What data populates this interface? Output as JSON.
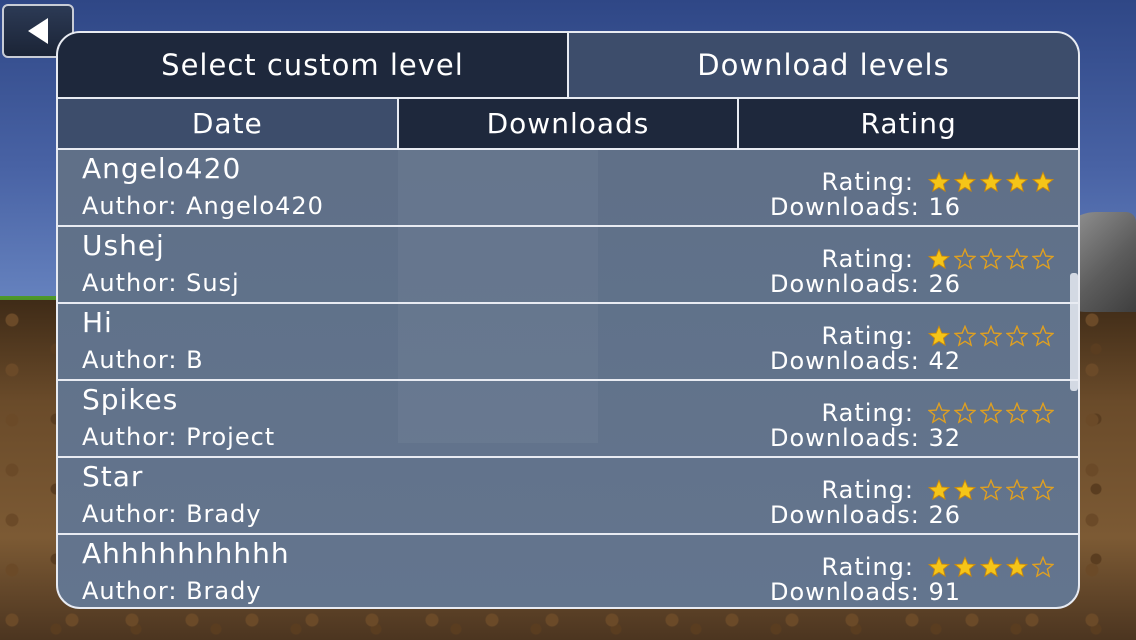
{
  "tabs": {
    "select_custom": "Select custom level",
    "download_levels": "Download levels"
  },
  "sort": {
    "date": "Date",
    "downloads": "Downloads",
    "rating": "Rating"
  },
  "labels": {
    "rating": "Rating:",
    "author_prefix": "Author:",
    "downloads_prefix": "Downloads:"
  },
  "levels": [
    {
      "title": "Angelo420",
      "author": "Author: Angelo420",
      "rating_stars": 5,
      "downloads": "Downloads: 16"
    },
    {
      "title": "Ushej",
      "author": "Author: Susj",
      "rating_stars": 1,
      "downloads": "Downloads: 26"
    },
    {
      "title": "Hi",
      "author": "Author: B",
      "rating_stars": 1,
      "downloads": "Downloads: 42"
    },
    {
      "title": "Spikes",
      "author": "Author: Project",
      "rating_stars": 0,
      "downloads": "Downloads: 32"
    },
    {
      "title": "Star",
      "author": "Author: Brady",
      "rating_stars": 2,
      "downloads": "Downloads: 26"
    },
    {
      "title": "Ahhhhhhhhhh",
      "author": "Author: Brady",
      "rating_stars": 4,
      "downloads": "Downloads: 91"
    }
  ],
  "colors": {
    "star_filled": "#f5c518",
    "star_outline": "#e0a020"
  },
  "icons": {
    "back": "back-arrow-icon",
    "star": "star-icon"
  }
}
